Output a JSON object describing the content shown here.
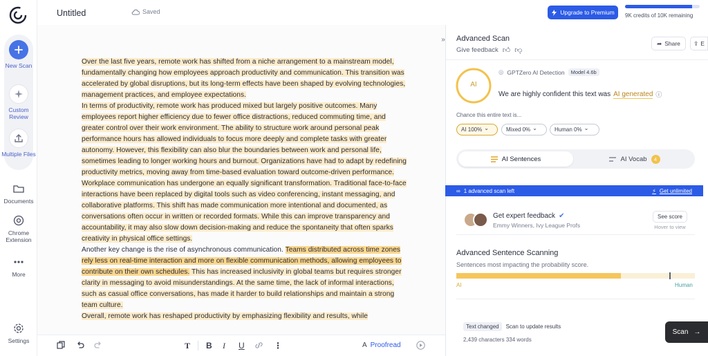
{
  "app": {
    "doc_title": "Untitled",
    "saved": "Saved"
  },
  "sidebar": {
    "items": [
      {
        "label": "New Scan",
        "icon": "plus-icon"
      },
      {
        "label": "Custom Review",
        "icon": "sparkle-icon"
      },
      {
        "label": "Multiple Files",
        "icon": "upload-icon"
      },
      {
        "label": "Documents",
        "icon": "folder-icon"
      },
      {
        "label": "Chrome Extension",
        "icon": "chrome-icon"
      },
      {
        "label": "More",
        "icon": "more-icon"
      },
      {
        "label": "Settings",
        "icon": "gear-icon"
      }
    ]
  },
  "header": {
    "premium_label": "Upgrade to Premium",
    "credits_text": "9K credits of 10K remaining",
    "credits_fraction": 0.9,
    "accent": "#2c5be6"
  },
  "editor": {
    "paragraphs": [
      {
        "segments": [
          {
            "t": "Over the last five years, remote work has shifted from a niche arrangement to a mainstream model, fundamentally changing how employees approach productivity and communication. This transition was accelerated by global disruptions, but its long-term effects have been shaped by evolving technologies, management practices, and employee expectations.",
            "h": 1
          }
        ]
      },
      {
        "segments": [
          {
            "t": "In terms of productivity, remote work has produced mixed but largely positive outcomes. Many employees report higher efficiency due to fewer office distractions, reduced commuting time, and greater control over their work environment. The ability to structure work around personal peak performance hours has allowed individuals to focus more deeply and complete tasks with greater autonomy. However, this flexibility can also blur the boundaries between work and personal life, sometimes leading to longer working hours and burnout. Organizations have had to adapt by redefining productivity metrics, moving away from time-based evaluation toward outcome-driven performance.",
            "h": 1
          }
        ]
      },
      {
        "segments": [
          {
            "t": "Workplace communication has undergone an equally significant transformation. Traditional face-to-face interactions have been replaced by digital tools such as video conferencing, instant messaging, and collaborative platforms. This shift has made communication more intentional and documented, as conversations often occur in written or recorded formats. While this can improve transparency and accountability, it may also slow down decision-making and reduce the spontaneity that often sparks creativity in physical office settings.",
            "h": 1
          }
        ]
      },
      {
        "segments": [
          {
            "t": "Another key change is the rise of asynchronous communication. ",
            "h": 0
          },
          {
            "t": "Teams distributed across time zones rely less on real-time interaction and more on flexible communication methods, allowing employees to contribute on their own schedules.",
            "h": 2
          },
          {
            "t": " This has increased inclusivity in global teams but requires stronger clarity in messaging to avoid misunderstandings. At the same time, the lack of informal interactions, such as casual office conversations, has made it harder to build relationships and maintain a strong team culture.",
            "h": 1
          }
        ]
      },
      {
        "segments": [
          {
            "t": "Overall, remote work has reshaped productivity by emphasizing flexibility and results, while",
            "h": 1
          }
        ]
      }
    ]
  },
  "toolbar": {
    "proofread": "Proofread"
  },
  "panel": {
    "title": "Advanced Scan",
    "feedback": "Give feedback",
    "share": "Share",
    "edit_short": "E",
    "badge_ai": "AI",
    "detector": "GPTZero AI Detection",
    "model": "Model 4.6b",
    "confidence_prefix": "We are highly confident this text was",
    "confidence_value": "AI generated",
    "chance_label": "Chance this entire text is...",
    "chips": [
      {
        "label": "AI 100%",
        "selected": true
      },
      {
        "label": "Mixed 0%",
        "selected": false
      },
      {
        "label": "Human 0%",
        "selected": false
      }
    ],
    "tabs": {
      "sentences": "AI Sentences",
      "vocab": "AI Vocab",
      "vocab_count": "4"
    },
    "banner": {
      "left": "1 advanced scan left",
      "right": "Get unlimited"
    },
    "expert": {
      "title": "Get expert feedback",
      "subtitle": "Emmy Winners, Ivy League Profs",
      "button": "See score",
      "hover": "Hover to view"
    },
    "adv": {
      "title": "Advanced Sentence Scanning",
      "subtitle": "Sentences most impacting the probability score.",
      "left": "AI",
      "right": "Human",
      "ai_fraction": 0.69
    },
    "status": {
      "badge": "Text changed",
      "text": "Scan to update results",
      "counts": "2,439 characters 334 words"
    },
    "scan_button": "Scan"
  }
}
